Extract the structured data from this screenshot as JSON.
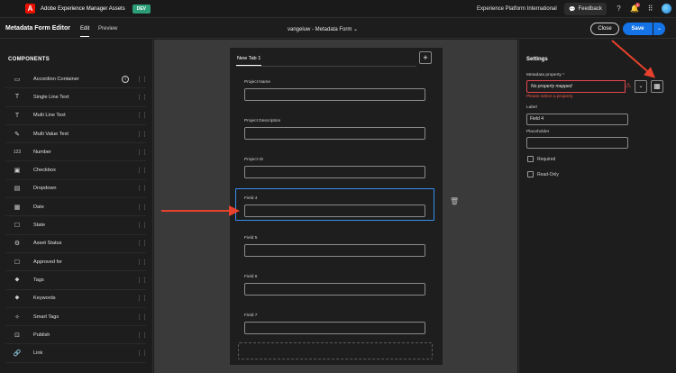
{
  "topbar": {
    "logo_letter": "A",
    "app_title": "Adobe Experience Manager Assets",
    "env_badge": "DEV",
    "org_name": "Experience Platform International",
    "feedback_label": "Feedback",
    "notification_count": "1"
  },
  "editor": {
    "title": "Metadata Form Editor",
    "tab_edit": "Edit",
    "tab_preview": "Preview",
    "document_title": "vangeluw - Metadata Form",
    "close_label": "Close",
    "save_label": "Save"
  },
  "components": {
    "heading": "COMPONENTS",
    "items": [
      {
        "label": "Accordion Container",
        "icon": "accordion-icon",
        "glyph": "▭"
      },
      {
        "label": "Single Line Text",
        "icon": "text-icon",
        "glyph": "T"
      },
      {
        "label": "Multi Line Text",
        "icon": "text-icon",
        "glyph": "T"
      },
      {
        "label": "Multi Value Text",
        "icon": "multi-value-icon",
        "glyph": "✎"
      },
      {
        "label": "Number",
        "icon": "number-icon",
        "glyph": "123"
      },
      {
        "label": "Checkbox",
        "icon": "checkbox-icon",
        "glyph": "▣"
      },
      {
        "label": "Dropdown",
        "icon": "dropdown-icon",
        "glyph": "▤"
      },
      {
        "label": "Date",
        "icon": "calendar-icon",
        "glyph": "▦"
      },
      {
        "label": "State",
        "icon": "state-icon",
        "glyph": "☐"
      },
      {
        "label": "Asset Status",
        "icon": "asset-status-icon",
        "glyph": "⚙"
      },
      {
        "label": "Approved for",
        "icon": "approved-icon",
        "glyph": "☐"
      },
      {
        "label": "Tags",
        "icon": "tag-icon",
        "glyph": "⬥"
      },
      {
        "label": "Keywords",
        "icon": "keyword-icon",
        "glyph": "⬥"
      },
      {
        "label": "Smart Tags",
        "icon": "smart-tag-icon",
        "glyph": "✧"
      },
      {
        "label": "Publish",
        "icon": "publish-icon",
        "glyph": "⊡"
      },
      {
        "label": "Link",
        "icon": "link-icon",
        "glyph": "🔗"
      }
    ]
  },
  "form": {
    "tab_label": "New Tab 1",
    "fields": [
      {
        "label": "Project Name"
      },
      {
        "label": "Project Description"
      },
      {
        "label": "Project ID"
      },
      {
        "label": "Field 4"
      },
      {
        "label": "Field 5"
      },
      {
        "label": "Field 6"
      },
      {
        "label": "Field 7"
      }
    ]
  },
  "settings": {
    "heading": "Settings",
    "metadata_property_label": "Metadata property",
    "required_marker": "*",
    "metadata_property_value": "No property mapped",
    "error_text": "Please select a property",
    "label_label": "Label",
    "label_value": "Field 4",
    "placeholder_label": "Placeholder",
    "placeholder_value": "",
    "required_label": "Required",
    "readonly_label": "Read-Only"
  },
  "colors": {
    "accent": "#1473e6",
    "error": "#e34850",
    "annotation_arrow": "#e8412c"
  }
}
